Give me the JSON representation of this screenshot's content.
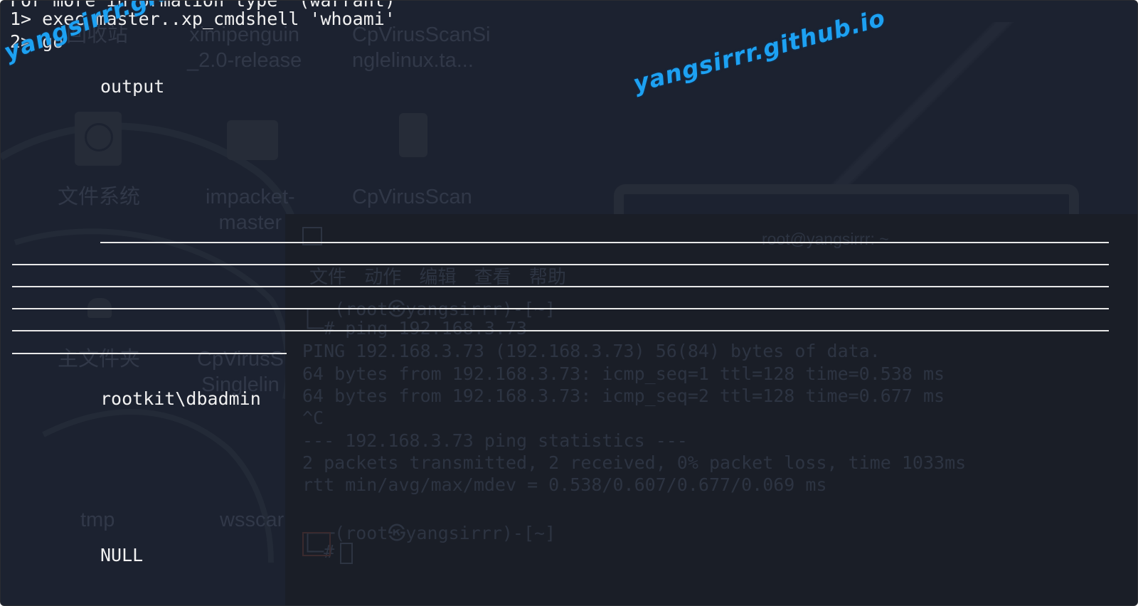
{
  "background": {
    "desktop_icons": [
      {
        "label": "回收站",
        "name": "desktop-icon-trash"
      },
      {
        "label": "ximipenguin\n_2.0-release",
        "name": "desktop-icon-ximipenguin"
      },
      {
        "label": "CpVirusScanSi\nnglelinux.ta...",
        "name": "desktop-icon-cpvirusscan-tar"
      },
      {
        "label": "文件系统",
        "name": "desktop-icon-filesystem"
      },
      {
        "label": "impacket-\nmaster",
        "name": "desktop-icon-impacket"
      },
      {
        "label": "CpVirusScan",
        "name": "desktop-icon-cpvirusscan"
      },
      {
        "label": "主文件夹",
        "name": "desktop-icon-home"
      },
      {
        "label": "CpVirusS\nSinglelin",
        "name": "desktop-icon-cpvirus-single"
      },
      {
        "label": "tmp",
        "name": "desktop-icon-tmp"
      },
      {
        "label": "wsscar",
        "name": "desktop-icon-wsscan"
      }
    ],
    "terminal_title": "root@yangsirrr: ~",
    "terminal_menu": "文件 动作 编辑 查看 帮助",
    "terminal_lines": [
      "┌──(root㉿yangsirrr)-[~]",
      "└─# ping 192.168.3.73",
      "PING 192.168.3.73 (192.168.3.73) 56(84) bytes of data.",
      "64 bytes from 192.168.3.73: icmp_seq=1 ttl=128 time=0.538 ms",
      "64 bytes from 192.168.3.73: icmp_seq=2 ttl=128 time=0.677 ms",
      "^C",
      "--- 192.168.3.73 ping statistics ---",
      "2 packets transmitted, 2 received, 0% packet loss, time 1033ms",
      "rtt min/avg/max/mdev = 0.538/0.607/0.677/0.069 ms",
      "",
      "┌──(root㉿yangsirrr)-[~]",
      "└─# "
    ]
  },
  "terminal": {
    "line_header": "For more information type \"(warrant)",
    "line1": "1> exec master..xp_cmdshell 'whoami'",
    "line2": "2> go",
    "output_header": "output",
    "output_value": "rootkit\\dbadmin",
    "null_value": "NULL"
  },
  "watermarks": {
    "left": "yangsirrr.github.io",
    "right": "yangsirrr.github.io",
    "color": "#1da1f2"
  }
}
